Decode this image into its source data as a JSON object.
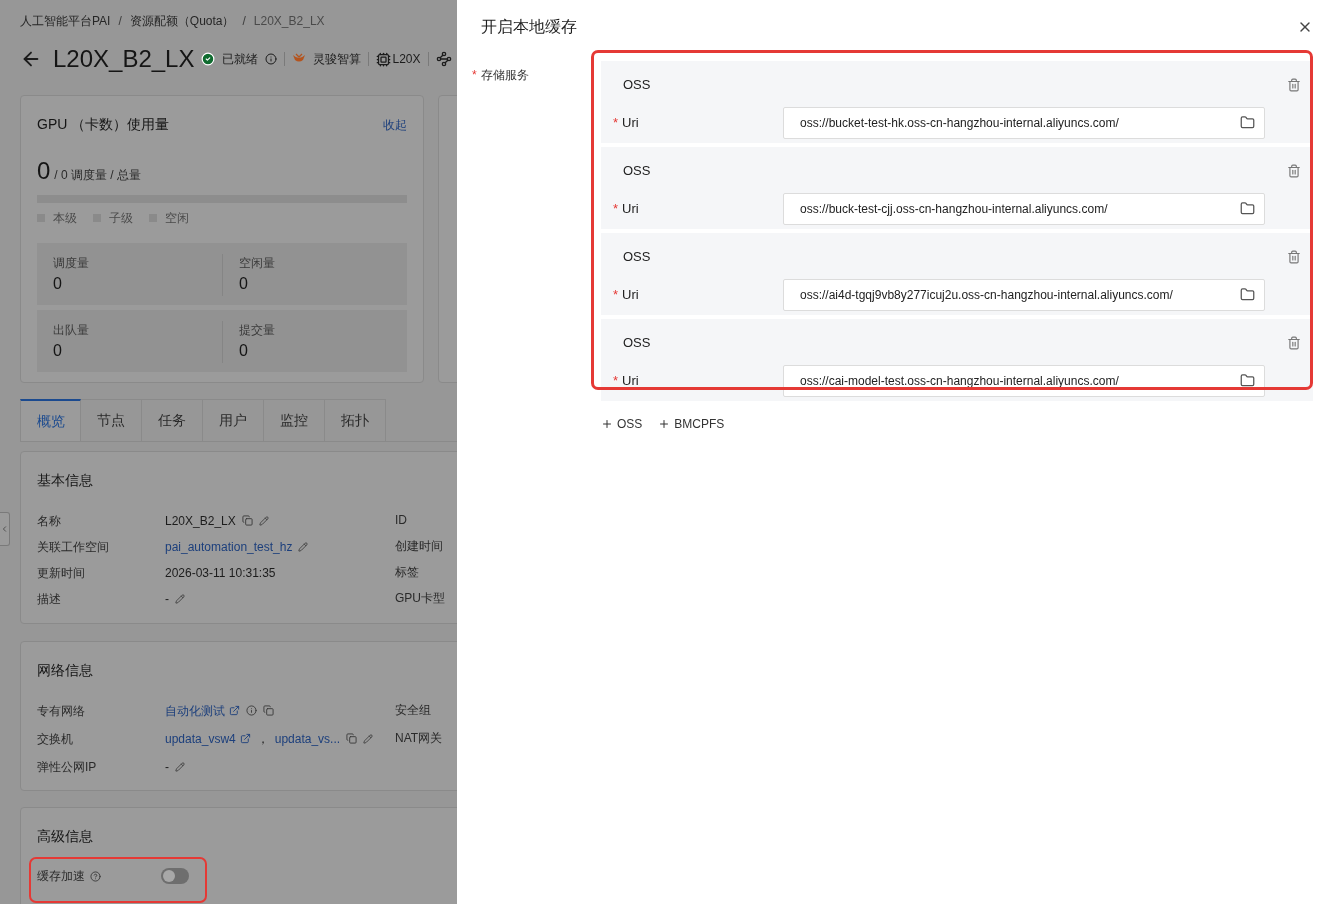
{
  "breadcrumb": [
    "人工智能平台PAI",
    "资源配额（Quota）",
    "L20X_B2_LX"
  ],
  "breadcrumb_separator": "/",
  "header": {
    "title": "L20X_B2_LX",
    "status": "已就绪",
    "product": "灵骏智算",
    "gpu_model": "L20X"
  },
  "gpu_card": {
    "title": "GPU （卡数）使用量",
    "collapse_link": "收起",
    "used": "0",
    "total_text": "/ 0 调度量 / 总量",
    "level": 0,
    "legend": [
      "本级",
      "子级",
      "空闲"
    ],
    "stats": [
      {
        "label": "调度量",
        "value": "0"
      },
      {
        "label": "空闲量",
        "value": "0"
      },
      {
        "label": "出队量",
        "value": "0"
      },
      {
        "label": "提交量",
        "value": "0"
      }
    ]
  },
  "tabs": [
    {
      "label": "概览",
      "selected": true
    },
    {
      "label": "节点",
      "selected": false
    },
    {
      "label": "任务",
      "selected": false
    },
    {
      "label": "用户",
      "selected": false
    },
    {
      "label": "监控",
      "selected": false
    },
    {
      "label": "拓扑",
      "selected": false
    }
  ],
  "basic_info": {
    "title": "基本信息",
    "right_labels": [
      "ID",
      "创建时间",
      "标签",
      "GPU卡型"
    ],
    "rows": [
      {
        "label": "名称",
        "values": [
          {
            "text": "L20X_B2_LX",
            "kind": "text",
            "external": false
          }
        ],
        "has_info": false,
        "copyable": true,
        "editable": true
      },
      {
        "label": "关联工作空间",
        "values": [
          {
            "text": "pai_automation_test_hz",
            "kind": "link",
            "external": false
          }
        ],
        "has_info": false,
        "copyable": false,
        "editable": true
      },
      {
        "label": "更新时间",
        "values": [
          {
            "text": "2026-03-11 10:31:35",
            "kind": "text",
            "external": false
          }
        ],
        "has_info": false,
        "copyable": false,
        "editable": false
      },
      {
        "label": "描述",
        "values": [
          {
            "text": "-",
            "kind": "text",
            "external": false
          }
        ],
        "has_info": false,
        "copyable": false,
        "editable": true
      }
    ]
  },
  "network_info": {
    "title": "网络信息",
    "right_labels": [
      "安全组",
      "NAT网关"
    ],
    "rows": [
      {
        "label": "专有网络",
        "values": [
          {
            "text": "自动化测试",
            "kind": "link",
            "external": true
          }
        ],
        "has_info": true,
        "copyable": true,
        "editable": false
      },
      {
        "label": "交换机",
        "values": [
          {
            "text": "updata_vsw4",
            "kind": "link",
            "external": true
          },
          {
            "text": "，",
            "kind": "text",
            "external": false
          },
          {
            "text": "updata_vs...",
            "kind": "link",
            "external": false
          }
        ],
        "has_info": false,
        "copyable": true,
        "editable": true
      },
      {
        "label": "弹性公网IP",
        "values": [
          {
            "text": "-",
            "kind": "text",
            "external": false
          }
        ],
        "has_info": false,
        "copyable": false,
        "editable": true
      }
    ]
  },
  "advanced_info": {
    "title": "高级信息",
    "cache_acceleration": {
      "label": "缓存加速",
      "on": false,
      "annotated": true
    }
  },
  "drawer": {
    "title": "开启本地缓存",
    "required_mark": "*",
    "field_label": "存储服务",
    "required": true,
    "annotated": true,
    "storages": [
      {
        "type": "OSS",
        "uri_label": "Uri",
        "required": true,
        "value": "oss://bucket-test-hk.oss-cn-hangzhou-internal.aliyuncs.com/"
      },
      {
        "type": "OSS",
        "uri_label": "Uri",
        "required": true,
        "value": "oss://buck-test-cjj.oss-cn-hangzhou-internal.aliyuncs.com/"
      },
      {
        "type": "OSS",
        "uri_label": "Uri",
        "required": true,
        "value": "oss://ai4d-tgqj9vb8y277icuj2u.oss-cn-hangzhou-internal.aliyuncs.com/"
      },
      {
        "type": "OSS",
        "uri_label": "Uri",
        "required": true,
        "value": "oss://cai-model-test.oss-cn-hangzhou-internal.aliyuncs.com/"
      }
    ],
    "add_buttons": [
      "OSS",
      "BMCPFS"
    ]
  }
}
